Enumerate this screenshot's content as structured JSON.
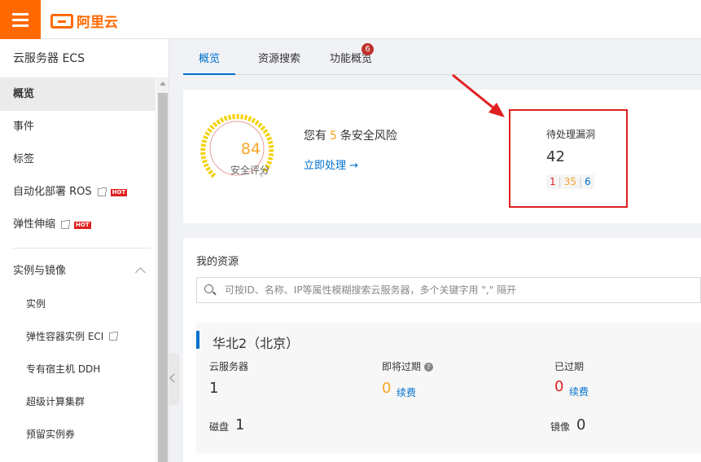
{
  "brand": {
    "logo_text": "阿里云",
    "accent": "#ff6a00"
  },
  "sidebar": {
    "title": "云服务器 ECS",
    "items": [
      {
        "label": "概览",
        "active": true
      },
      {
        "label": "事件"
      },
      {
        "label": "标签"
      },
      {
        "label": "自动化部署 ROS",
        "external": true,
        "hot": "HOT"
      },
      {
        "label": "弹性伸缩",
        "external": true,
        "hot": "HOT"
      }
    ],
    "group": {
      "label": "实例与镜像",
      "items": [
        {
          "label": "实例"
        },
        {
          "label": "弹性容器实例 ECI",
          "external": true
        },
        {
          "label": "专有宿主机 DDH"
        },
        {
          "label": "超级计算集群"
        },
        {
          "label": "预留实例券"
        }
      ]
    }
  },
  "tabs": [
    {
      "label": "概览",
      "active": true
    },
    {
      "label": "资源搜索"
    },
    {
      "label": "功能概览",
      "badge": "6"
    }
  ],
  "security": {
    "score": "84",
    "score_label": "安全评分",
    "risk_prefix": "您有",
    "risk_count": "5",
    "risk_suffix": "条安全风险",
    "fix_link": "立即处理 →",
    "vuln_title": "待处理漏洞",
    "vuln_total": "42",
    "vuln_high": "1",
    "vuln_mid": "35",
    "vuln_low": "6",
    "sep": "|"
  },
  "resources": {
    "title": "我的资源",
    "search_placeholder": "可按ID、名称、IP等属性模糊搜索云服务器，多个关键字用 \",\" 隔开",
    "region": {
      "name": "华北2（北京）",
      "servers_label": "云服务器",
      "servers_count": "1",
      "expiring_label": "即将过期",
      "expiring_count": "0",
      "expired_label": "已过期",
      "expired_count": "0",
      "renew_label": "续费",
      "disk_label": "磁盘",
      "disk_count": "1",
      "image_label": "镜像",
      "image_count": "0"
    }
  }
}
